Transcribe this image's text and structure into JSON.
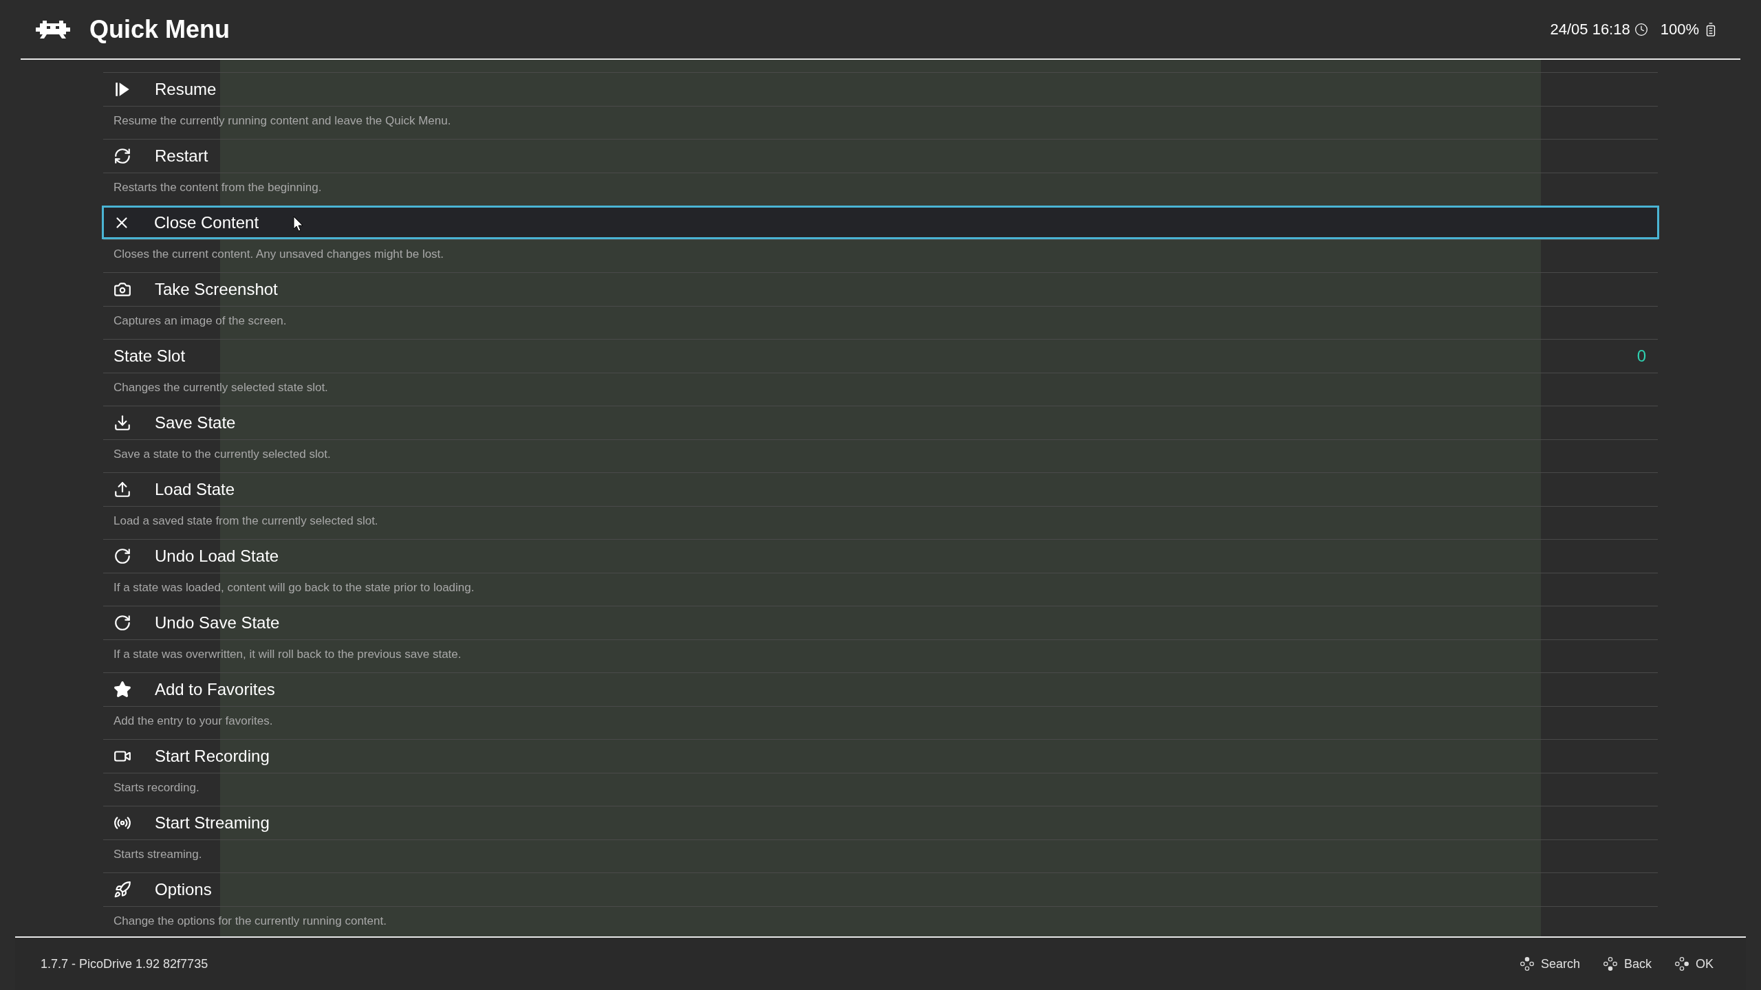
{
  "header": {
    "title": "Quick Menu",
    "datetime": "24/05 16:18",
    "battery": "100%"
  },
  "items": [
    {
      "label": "Resume",
      "description": "Resume the currently running content and leave the Quick Menu.",
      "selected": false
    },
    {
      "label": "Restart",
      "description": "Restarts the content from the beginning.",
      "selected": false
    },
    {
      "label": "Close Content",
      "description": "Closes the current content. Any unsaved changes might be lost.",
      "selected": true
    },
    {
      "label": "Take Screenshot",
      "description": "Captures an image of the screen.",
      "selected": false
    },
    {
      "label": "State Slot",
      "value": "0",
      "description": "Changes the currently selected state slot.",
      "selected": false
    },
    {
      "label": "Save State",
      "description": "Save a state to the currently selected slot.",
      "selected": false
    },
    {
      "label": "Load State",
      "description": "Load a saved state from the currently selected slot.",
      "selected": false
    },
    {
      "label": "Undo Load State",
      "description": "If a state was loaded, content will go back to the state prior to loading.",
      "selected": false
    },
    {
      "label": "Undo Save State",
      "description": "If a state was overwritten, it will roll back to the previous save state.",
      "selected": false
    },
    {
      "label": "Add to Favorites",
      "description": "Add the entry to your favorites.",
      "selected": false
    },
    {
      "label": "Start Recording",
      "description": "Starts recording.",
      "selected": false
    },
    {
      "label": "Start Streaming",
      "description": "Starts streaming.",
      "selected": false
    },
    {
      "label": "Options",
      "description": "Change the options for the currently running content.",
      "selected": false
    }
  ],
  "footer": {
    "version": "1.7.7 - PicoDrive 1.92 82f7735",
    "actions": [
      {
        "label": "Search"
      },
      {
        "label": "Back"
      },
      {
        "label": "OK"
      }
    ]
  }
}
